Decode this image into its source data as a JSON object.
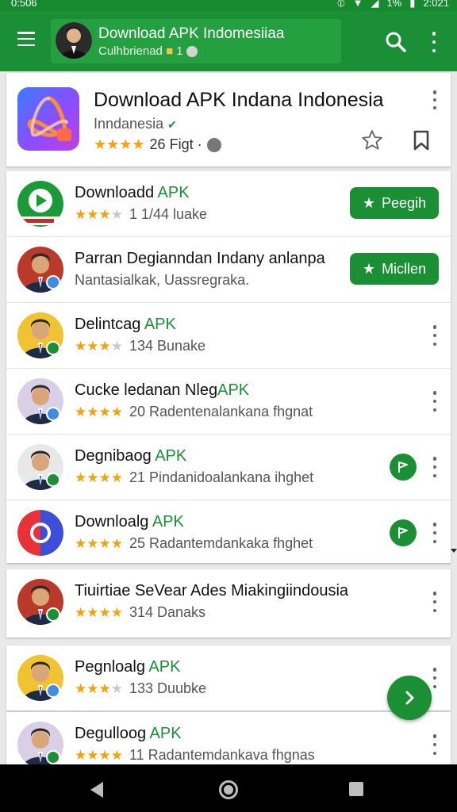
{
  "status_bar": {
    "time": "0:506",
    "right_text": "1%",
    "clock": "2:021"
  },
  "app_bar": {
    "title": "Download APK Indomesiiaa",
    "subtitle": "Culhbrienad",
    "subtitle_suffix": "1",
    "accent": "#1a8f35"
  },
  "header_card": {
    "title": "Download APK Indana Indonesia",
    "subtitle": "Inndanesia",
    "stars": 4,
    "rating_text": "26 Figt ·"
  },
  "list": [
    {
      "title": "Downloadd ",
      "title_apk": "APK",
      "stars": 3,
      "meta": "1 1/44 luake",
      "action": "pill",
      "action_label": "Peegih",
      "avatar": "logo"
    },
    {
      "title": "Parran Degianndan Indany anlanpa",
      "title_apk": "",
      "stars": 0,
      "meta": "Nantasialkak, Uassregraka.",
      "action": "pill",
      "action_label": "Micllen",
      "avatar": "person"
    },
    {
      "title": "Delintcag ",
      "title_apk": "APK",
      "stars": 3,
      "meta": "134 Bunake",
      "action": "more",
      "action_label": "",
      "avatar": "person"
    },
    {
      "title": "Cucke ledanan Nleg",
      "title_apk": "APK",
      "stars": 4,
      "meta": "20 Radentenalankana fhgnat",
      "action": "more",
      "action_label": "",
      "avatar": "person"
    },
    {
      "title": "Degnibaog ",
      "title_apk": "APK",
      "stars": 4,
      "meta": "21 Pindanidoalankana ihghet",
      "action": "circle",
      "action_label": "",
      "avatar": "person"
    },
    {
      "title": "Downloalg ",
      "title_apk": "APK",
      "stars": 4,
      "meta": "25 Radantemdankaka fhghet",
      "action": "circle",
      "action_label": "",
      "avatar": "logo2"
    }
  ],
  "single_cards": [
    {
      "title": "Tiuirtiae SeVear Ades Miakingiindousia",
      "title_apk": "",
      "stars": 4,
      "meta": "314 Danaks"
    },
    {
      "title": "Pegnloalg ",
      "title_apk": "APK",
      "stars": 3,
      "meta": "133 Duubke"
    },
    {
      "title": "Degulloog ",
      "title_apk": "APK",
      "stars": 4,
      "meta": "11  Radantemdankava fhgnas"
    }
  ]
}
